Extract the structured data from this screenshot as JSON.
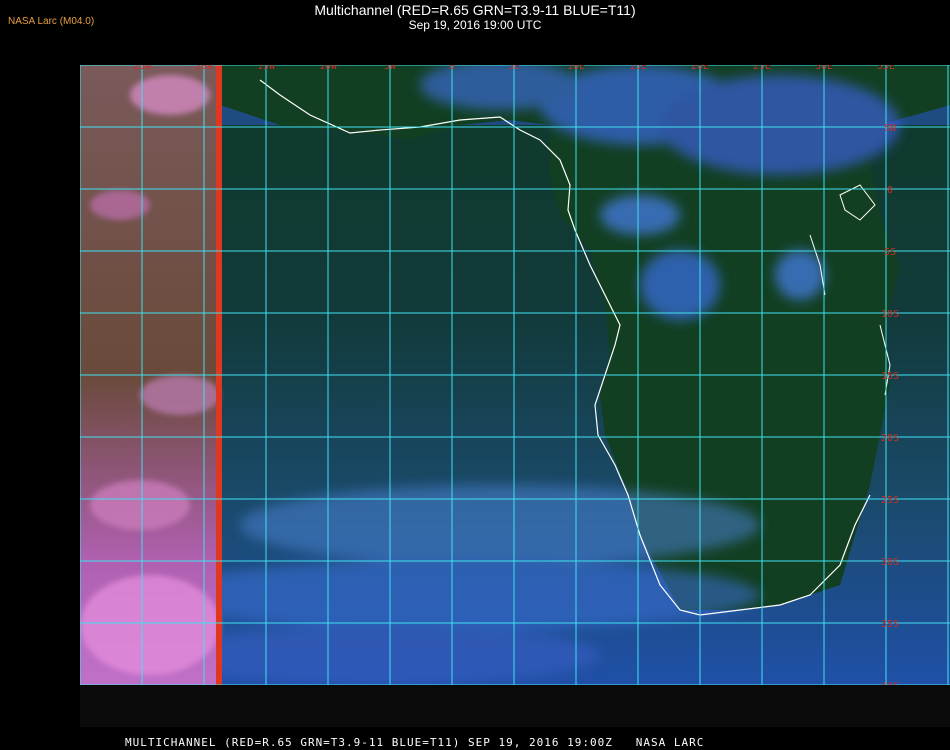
{
  "header": {
    "credit": "NASA Larc (M04.0)",
    "title": "Multichannel (RED=R.65 GRN=T3.9-11 BLUE=T11)",
    "subtitle": "Sep 19, 2016 19:00 UTC"
  },
  "map": {
    "lon_labels": [
      "25W",
      "20W",
      "15W",
      "10W",
      "5W",
      "0",
      "5E",
      "10E",
      "15E",
      "20E",
      "25E",
      "30E",
      "35E"
    ],
    "lat_labels": [
      "5N",
      "0",
      "5S",
      "10S",
      "15S",
      "20S",
      "25S",
      "30S",
      "35S",
      "40S"
    ],
    "grid_color": "#40e0f0",
    "label_color": "#c83028",
    "coast_color": "#ffffff"
  },
  "footer": {
    "text": "MULTICHANNEL (RED=R.65 GRN=T3.9-11 BLUE=T11) SEP 19, 2016 19:00Z   NASA LARC"
  }
}
